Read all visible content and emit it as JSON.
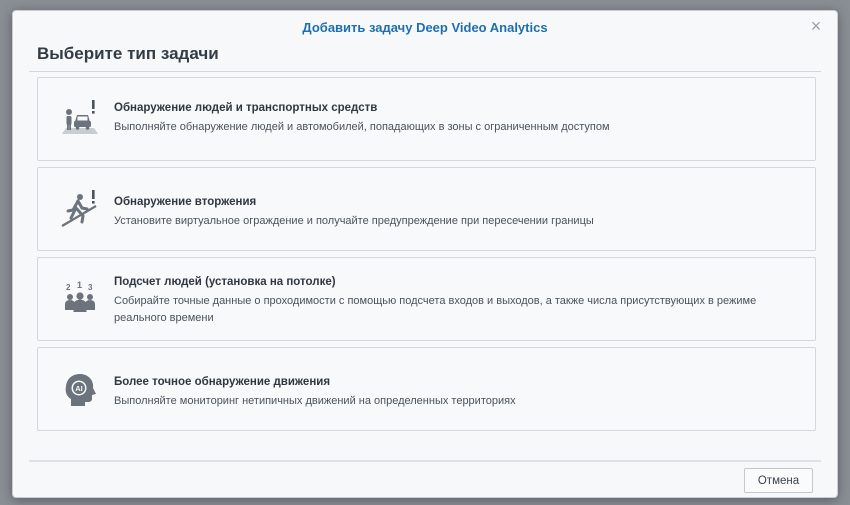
{
  "dialog": {
    "title": "Добавить задачу Deep Video Analytics",
    "close_label": "×",
    "header": "Выберите тип задачи",
    "options": [
      {
        "icon": "person-vehicle-alert-icon",
        "name": "Обнаружение людей и транспортных средств",
        "description": "Выполняйте обнаружение людей и автомобилей, попадающих в зоны с ограниченным доступом"
      },
      {
        "icon": "running-person-intrusion-icon",
        "name": "Обнаружение вторжения",
        "description": "Установите виртуальное ограждение и получайте предупреждение при пересечении границы"
      },
      {
        "icon": "people-counting-icon",
        "name": "Подсчет людей (установка на потолке)",
        "description": "Собирайте точные данные о проходимости с помощью подсчета входов и выходов, а также числа присутствующих в режиме реального времени"
      },
      {
        "icon": "ai-head-icon",
        "name": "Более точное обнаружение движения",
        "description": "Выполняйте мониторинг нетипичных движений на определенных территориях"
      }
    ],
    "cancel_label": "Отмена",
    "counting_icon_digits": [
      "2",
      "1",
      "3"
    ],
    "ai_icon_text": "AI"
  }
}
